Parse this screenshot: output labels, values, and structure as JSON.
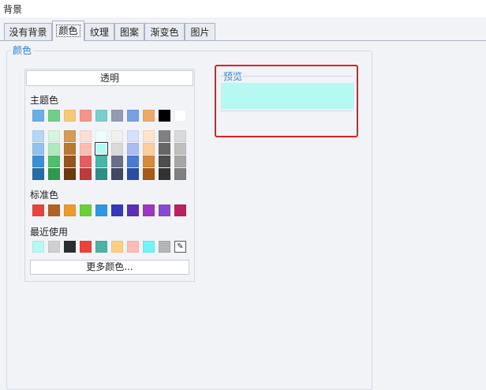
{
  "window": {
    "title": "背景"
  },
  "tabs": [
    {
      "label": "没有背景",
      "active": false
    },
    {
      "label": "颜色",
      "active": true
    },
    {
      "label": "纹理",
      "active": false
    },
    {
      "label": "图案",
      "active": false
    },
    {
      "label": "渐变色",
      "active": false
    },
    {
      "label": "图片",
      "active": false
    }
  ],
  "color_group": {
    "legend": "颜色",
    "transparent_button": "透明",
    "theme_label": "主题色",
    "standard_label": "标准色",
    "recent_label": "最近使用",
    "more_colors_button": "更多颜色...",
    "eyedropper_icon": "eyedropper-icon",
    "theme_top_row": [
      "#6aaee8",
      "#6fcf8a",
      "#f7c97c",
      "#f4958a",
      "#7ccfcb",
      "#959bb0",
      "#79a0e0",
      "#f0a86a",
      "#000000",
      "#ffffff"
    ],
    "theme_shades": [
      [
        "#b5d6f5",
        "#d7f4dc",
        "#d59b57",
        "#ffdcd6",
        "#eefcfb",
        "#f0f0f0",
        "#d6e0ff",
        "#ffe4c8",
        "#808080",
        "#d9d9d9"
      ],
      [
        "#90c3f0",
        "#aeeabb",
        "#b87a33",
        "#ffbcb2",
        "#b6f8f2",
        "#d9d9d9",
        "#aabdf2",
        "#fccc9a",
        "#666666",
        "#bfbfbf"
      ],
      [
        "#3a90d5",
        "#4fbf6b",
        "#94561c",
        "#e55e5e",
        "#48b5a8",
        "#6a6f87",
        "#4c79d1",
        "#d68a3a",
        "#4d4d4d",
        "#a6a6a6"
      ],
      [
        "#236ea8",
        "#2f9a4e",
        "#6d3a0c",
        "#bf3a3a",
        "#2e8f86",
        "#434762",
        "#2a4da3",
        "#a85a18",
        "#333333",
        "#808080"
      ]
    ],
    "theme_selected": {
      "row": 1,
      "col": 4
    },
    "standard_colors": [
      "#e9443a",
      "#b36224",
      "#ec9a2c",
      "#6ccf3b",
      "#2f98df",
      "#3639b8",
      "#5d2fb4",
      "#9b37c2",
      "#8b48d6",
      "#bb2060"
    ],
    "recent_colors": [
      "#b6f8f2",
      "#cfcfcf",
      "#2a2e33",
      "#e9443a",
      "#4fb0a5",
      "#fcd083",
      "#ffbcb2",
      "#6ef5f7",
      "#b4b4b4"
    ]
  },
  "preview": {
    "legend": "预览",
    "color": "#b6f8f2"
  },
  "colors": {
    "accent": "#2a7fd4",
    "highlight": "#e02020"
  }
}
